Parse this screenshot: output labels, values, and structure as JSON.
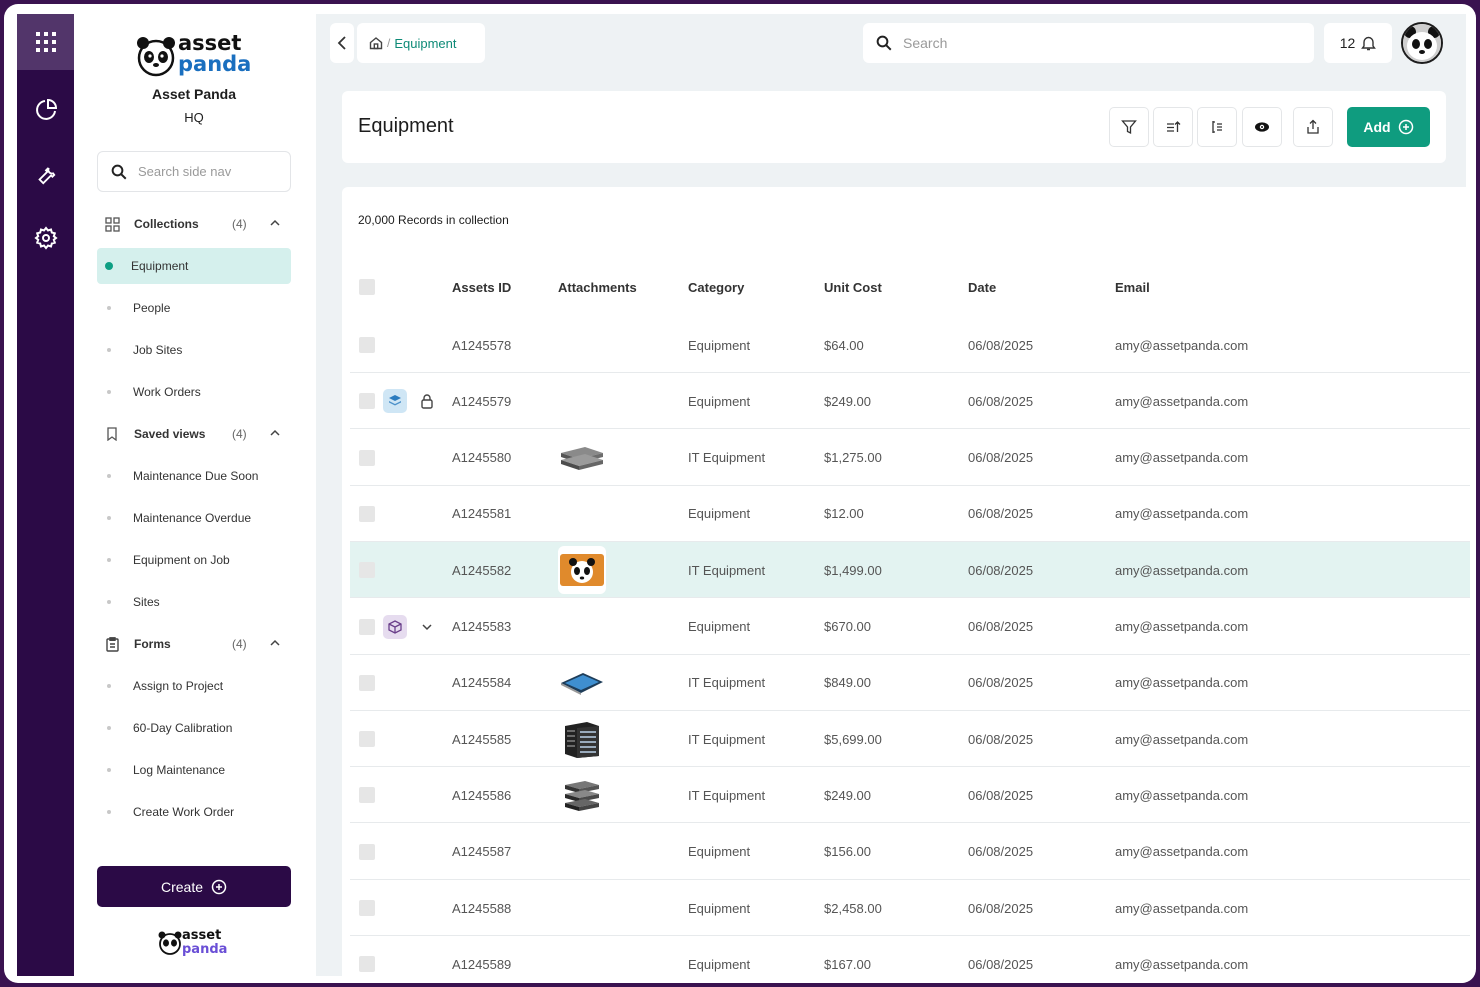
{
  "brand": {
    "logo_line1": "asset",
    "logo_line2": "panda",
    "name": "Asset Panda",
    "location": "HQ"
  },
  "rail": {
    "icons": [
      "apps-grid-icon",
      "pie-chart-icon",
      "wrench-icon",
      "gear-icon"
    ]
  },
  "sidenav": {
    "search_placeholder": "Search side nav",
    "sections": [
      {
        "key": "collections",
        "label": "Collections",
        "count": "(4)",
        "icon": "grid-icon",
        "items": [
          "Equipment",
          "People",
          "Job Sites",
          "Work Orders"
        ]
      },
      {
        "key": "saved_views",
        "label": "Saved views",
        "count": "(4)",
        "icon": "bookmark-icon",
        "items": [
          "Maintenance Due Soon",
          "Maintenance Overdue",
          "Equipment on Job",
          "Sites"
        ]
      },
      {
        "key": "forms",
        "label": "Forms",
        "count": "(4)",
        "icon": "clipboard-icon",
        "items": [
          "Assign to Project",
          "60-Day Calibration",
          "Log Maintenance",
          "Create Work Order"
        ]
      }
    ],
    "active_item": "Equipment",
    "create_label": "Create"
  },
  "topbar": {
    "breadcrumb_current": "Equipment",
    "breadcrumb_separator": "/",
    "search_placeholder": "Search",
    "notification_count": "12"
  },
  "header": {
    "title": "Equipment",
    "add_label": "Add"
  },
  "table": {
    "records_label": "20,000 Records in collection",
    "columns": [
      "Assets ID",
      "Attachments",
      "Category",
      "Unit Cost",
      "Date",
      "Email"
    ],
    "rows": [
      {
        "id": "A1245578",
        "category": "Equipment",
        "cost": "$64.00",
        "date": "06/08/2025",
        "email": "amy@assetpanda.com",
        "attachment": ""
      },
      {
        "id": "A1245579",
        "category": "Equipment",
        "cost": "$249.00",
        "date": "06/08/2025",
        "email": "amy@assetpanda.com",
        "attachment": "",
        "tags": [
          "layers-icon",
          "lock-icon"
        ]
      },
      {
        "id": "A1245580",
        "category": "IT Equipment",
        "cost": "$1,275.00",
        "date": "06/08/2025",
        "email": "amy@assetpanda.com",
        "attachment": "server-blades-image"
      },
      {
        "id": "A1245581",
        "category": "Equipment",
        "cost": "$12.00",
        "date": "06/08/2025",
        "email": "amy@assetpanda.com",
        "attachment": ""
      },
      {
        "id": "A1245582",
        "category": "IT Equipment",
        "cost": "$1,499.00",
        "date": "06/08/2025",
        "email": "amy@assetpanda.com",
        "attachment": "panda-photo-image",
        "highlight": true
      },
      {
        "id": "A1245583",
        "category": "Equipment",
        "cost": "$670.00",
        "date": "06/08/2025",
        "email": "amy@assetpanda.com",
        "attachment": "",
        "tags": [
          "box-icon",
          "chevron-down-icon"
        ]
      },
      {
        "id": "A1245584",
        "category": "IT Equipment",
        "cost": "$849.00",
        "date": "06/08/2025",
        "email": "amy@assetpanda.com",
        "attachment": "tablet-image"
      },
      {
        "id": "A1245585",
        "category": "IT Equipment",
        "cost": "$5,699.00",
        "date": "06/08/2025",
        "email": "amy@assetpanda.com",
        "attachment": "server-rack-image"
      },
      {
        "id": "A1245586",
        "category": "IT Equipment",
        "cost": "$249.00",
        "date": "06/08/2025",
        "email": "amy@assetpanda.com",
        "attachment": "network-switch-image"
      },
      {
        "id": "A1245587",
        "category": "Equipment",
        "cost": "$156.00",
        "date": "06/08/2025",
        "email": "amy@assetpanda.com",
        "attachment": ""
      },
      {
        "id": "A1245588",
        "category": "Equipment",
        "cost": "$2,458.00",
        "date": "06/08/2025",
        "email": "amy@assetpanda.com",
        "attachment": ""
      },
      {
        "id": "A1245589",
        "category": "Equipment",
        "cost": "$167.00",
        "date": "06/08/2025",
        "email": "amy@assetpanda.com",
        "attachment": ""
      }
    ]
  },
  "colors": {
    "rail": "#2b0a46",
    "accent": "#0f9c7f",
    "active_bg": "#d5f0ed",
    "highlight_row": "#e3f3f1"
  }
}
